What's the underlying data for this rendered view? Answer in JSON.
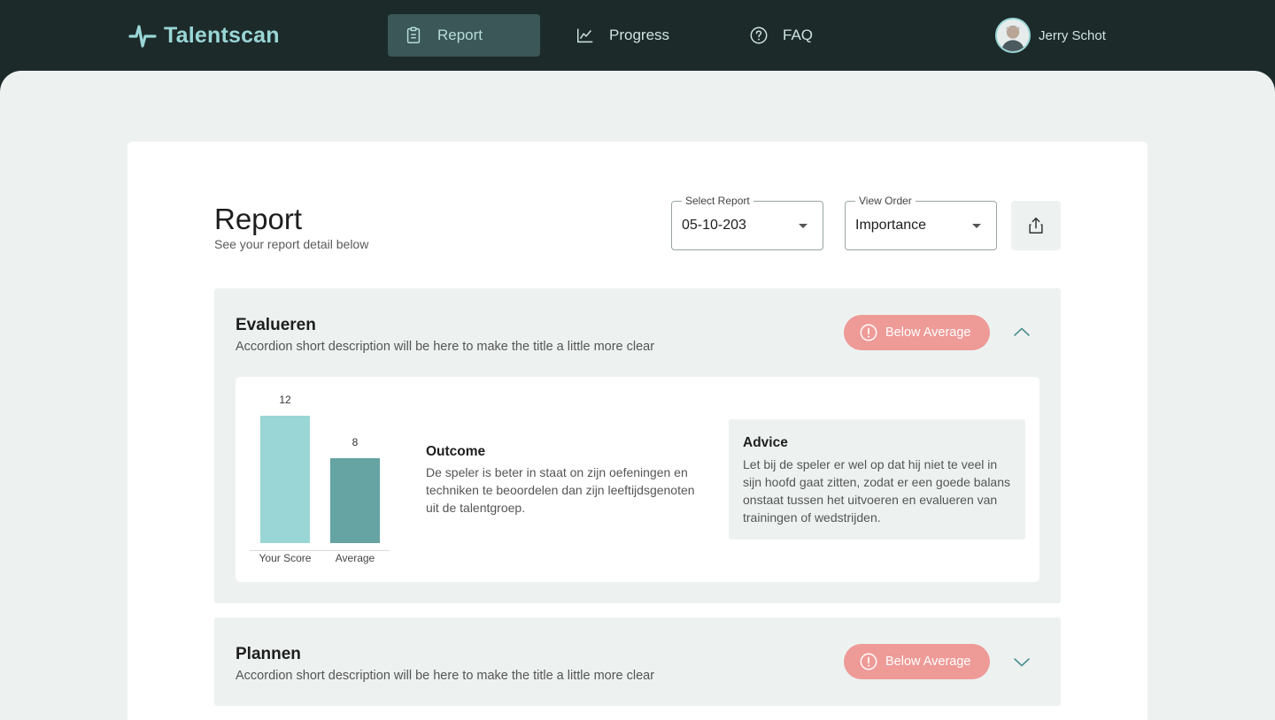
{
  "app": {
    "name": "Talentscan"
  },
  "nav": {
    "items": [
      {
        "label": "Report",
        "icon": "clipboard-icon",
        "active": true
      },
      {
        "label": "Progress",
        "icon": "line-chart-icon",
        "active": false
      },
      {
        "label": "FAQ",
        "icon": "help-circle-icon",
        "active": false
      }
    ]
  },
  "user": {
    "name": "Jerry Schot"
  },
  "page": {
    "title": "Report",
    "subtitle": "See your report detail below"
  },
  "controls": {
    "select_report": {
      "label": "Select Report",
      "value": "05-10-203"
    },
    "view_order": {
      "label": "View Order",
      "value": "Importance"
    },
    "share_icon": "share-icon"
  },
  "colors": {
    "brand_dark": "#1d2a2a",
    "accent": "#9ad6d6",
    "badge_warning": "#ee9a97",
    "bar_your_score": "#9ad6d6",
    "bar_average": "#66a3a3"
  },
  "accordions": [
    {
      "title": "Evalueren",
      "description": "Accordion short description will be here to make the title a little more clear",
      "status": "Below Average",
      "expanded": true,
      "outcome_title": "Outcome",
      "outcome_text": "De speler is beter in staat on zijn oefeningen en techniken te beoordelen dan zijn leeftijdsgenoten uit de talentgroep.",
      "advice_title": "Advice",
      "advice_text": "Let bij de speler er wel op dat hij niet te veel in sijn hoofd gaat zitten, zodat er een goede balans onstaat tussen het uitvoeren en evalueren van trainingen of wedstrijden."
    },
    {
      "title": "Plannen",
      "description": "Accordion short description will be here to make the title a little more clear",
      "status": "Below Average",
      "expanded": false
    }
  ],
  "chart_data": {
    "type": "bar",
    "categories": [
      "Your Score",
      "Average"
    ],
    "values": [
      12,
      8
    ],
    "data_labels": [
      "12",
      "8"
    ],
    "ylim": [
      0,
      12
    ],
    "grid": false,
    "title": "",
    "xlabel": "",
    "ylabel": ""
  }
}
